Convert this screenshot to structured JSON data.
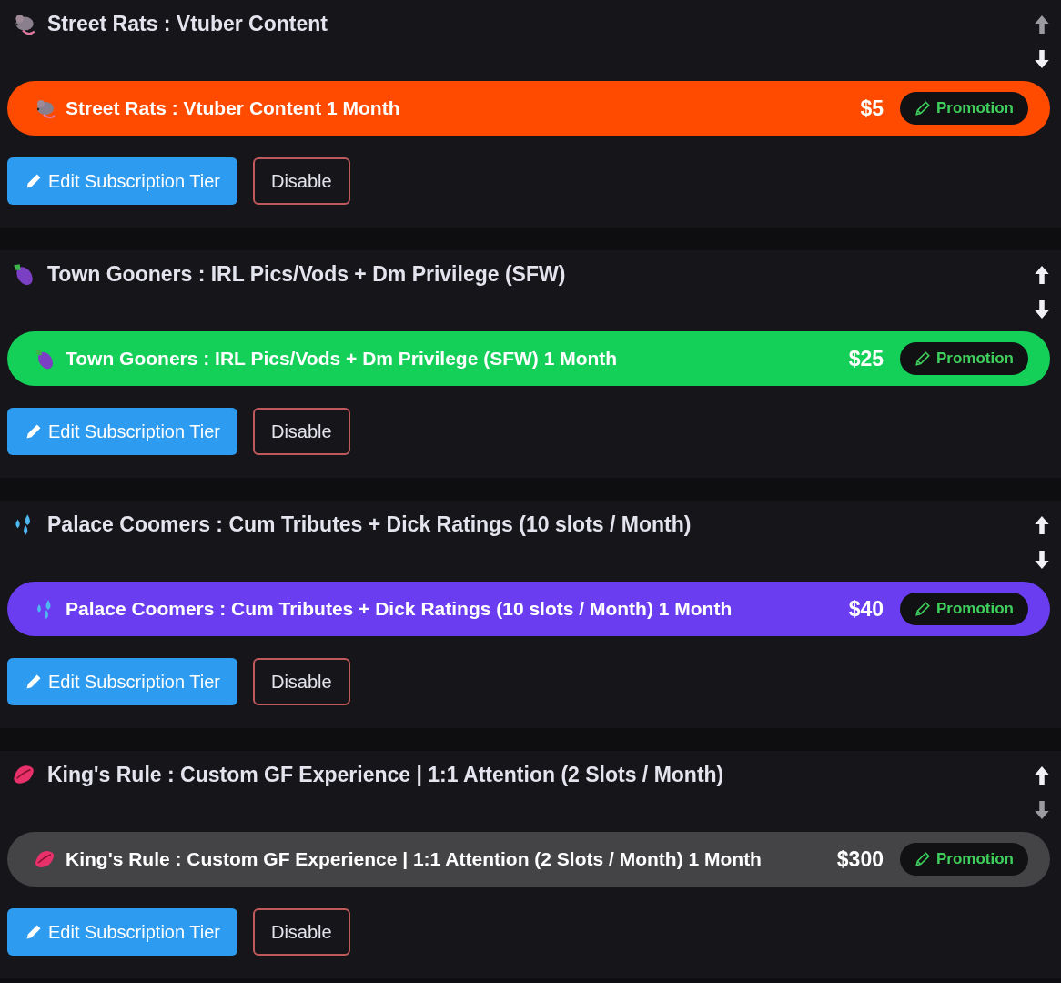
{
  "tiers": [
    {
      "title": "Street Rats : Vtuber Content",
      "move_up": {
        "disabled": true
      },
      "move_down": {
        "disabled": false
      },
      "plan": {
        "label": "Street Rats : Vtuber Content 1 Month",
        "price": "$5",
        "color": "#ff4b00",
        "promotion": "Promotion"
      },
      "edit_button": "Edit Subscription Tier",
      "disable_button": "Disable"
    },
    {
      "title": "Town Gooners : IRL Pics/Vods + Dm Privilege (SFW)",
      "move_up": {
        "disabled": false
      },
      "move_down": {
        "disabled": false
      },
      "plan": {
        "label": "Town Gooners : IRL Pics/Vods + Dm Privilege (SFW) 1 Month",
        "price": "$25",
        "color": "#14cf58",
        "promotion": "Promotion"
      },
      "edit_button": "Edit Subscription Tier",
      "disable_button": "Disable"
    },
    {
      "title": "Palace Coomers : Cum Tributes + Dick Ratings (10 slots / Month)",
      "move_up": {
        "disabled": false
      },
      "move_down": {
        "disabled": false
      },
      "plan": {
        "label": "Palace Coomers : Cum Tributes + Dick Ratings (10 slots / Month) 1 Month",
        "price": "$40",
        "color": "#6a3ef0",
        "promotion": "Promotion"
      },
      "edit_button": "Edit Subscription Tier",
      "disable_button": "Disable"
    },
    {
      "title": "King's Rule : Custom GF Experience | 1:1 Attention (2 Slots / Month)",
      "move_up": {
        "disabled": false
      },
      "move_down": {
        "disabled": true
      },
      "plan": {
        "label": "King's Rule : Custom GF Experience | 1:1 Attention (2 Slots / Month) 1 Month",
        "price": "$300",
        "color": "#444446",
        "promotion": "Promotion"
      },
      "edit_button": "Edit Subscription Tier",
      "disable_button": "Disable"
    }
  ]
}
